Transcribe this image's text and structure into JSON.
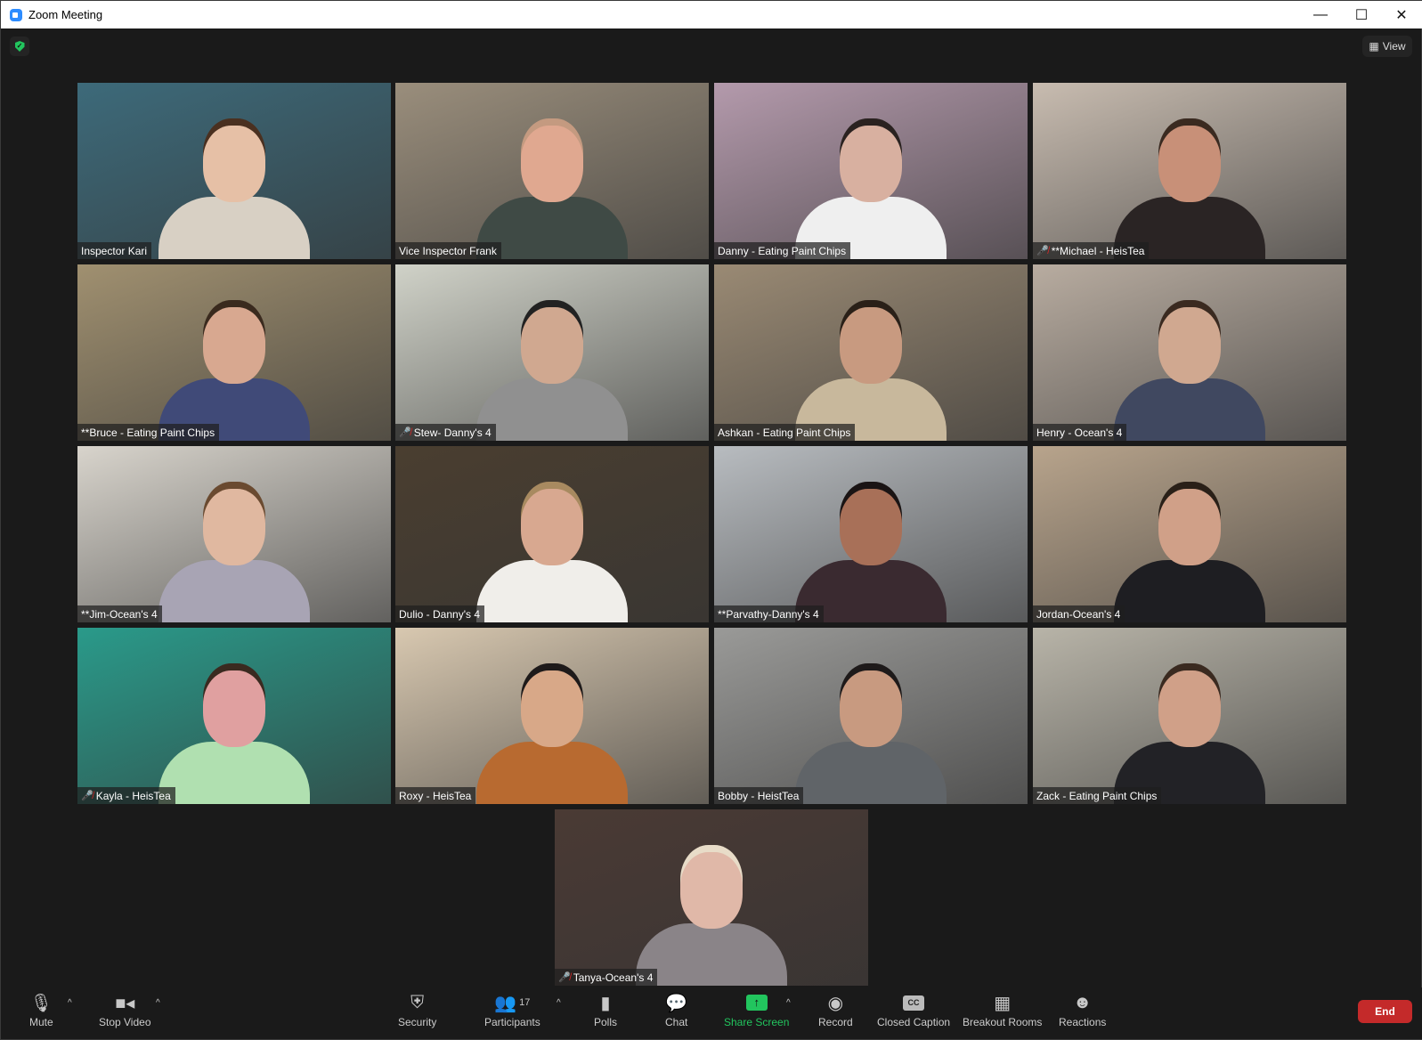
{
  "window": {
    "title": "Zoom Meeting",
    "minimize": "—",
    "maximize": "☐",
    "close": "✕"
  },
  "header": {
    "view_label": "View",
    "security_status": "encrypted"
  },
  "active_speaker": "Vice Inspector Frank",
  "participants": [
    {
      "name": "Inspector Kari",
      "muted": false,
      "bg": "#3d6a7a",
      "skin": "#e6c0a6",
      "shirt": "#d8d0c4",
      "hair": "#4a3020"
    },
    {
      "name": "Vice Inspector Frank",
      "muted": false,
      "bg": "#9a8e7c",
      "skin": "#e0a890",
      "shirt": "#3f4a45",
      "hair": "#c49a80"
    },
    {
      "name": "Danny - Eating Paint Chips",
      "muted": false,
      "bg": "#b49aac",
      "skin": "#d8b0a0",
      "shirt": "#efefef",
      "hair": "#2a2220"
    },
    {
      "name": "**Michael - HeisTea",
      "muted": true,
      "bg": "#c8bcb0",
      "skin": "#c89078",
      "shirt": "#2a2424",
      "hair": "#3a2a20"
    },
    {
      "name": "**Bruce - Eating Paint Chips",
      "muted": false,
      "bg": "#a09070",
      "skin": "#d8a890",
      "shirt": "#404a78",
      "hair": "#3a2a1e"
    },
    {
      "name": "Stew- Danny's 4",
      "muted": true,
      "bg": "#d0d2c8",
      "skin": "#d0a890",
      "shirt": "#909090",
      "hair": "#222"
    },
    {
      "name": "Ashkan - Eating Paint Chips",
      "muted": false,
      "bg": "#9a8a74",
      "skin": "#c89a80",
      "shirt": "#c8b89c",
      "hair": "#2a2018"
    },
    {
      "name": "Henry - Ocean's 4",
      "muted": false,
      "bg": "#b8aca0",
      "skin": "#d0a890",
      "shirt": "#404860",
      "hair": "#3a2a20"
    },
    {
      "name": "**Jim-Ocean's 4",
      "muted": false,
      "bg": "#d8d4cc",
      "skin": "#e0b8a0",
      "shirt": "#a8a4b4",
      "hair": "#6a4a30"
    },
    {
      "name": "Dulio - Danny's 4",
      "muted": false,
      "bg": "#4a3e30",
      "skin": "#d8a890",
      "shirt": "#f0eeea",
      "hair": "#a88a60"
    },
    {
      "name": "**Parvathy-Danny's 4",
      "muted": false,
      "bg": "#b8bcc0",
      "skin": "#a87058",
      "shirt": "#3a2a30",
      "hair": "#1a1414"
    },
    {
      "name": "Jordan-Ocean's 4",
      "muted": false,
      "bg": "#b8a48c",
      "skin": "#d0a088",
      "shirt": "#1e1e22",
      "hair": "#2a2018"
    },
    {
      "name": "Kayla - HeisTea",
      "muted": true,
      "bg": "#2a9a8a",
      "skin": "#e0a0a0",
      "shirt": "#b0e0b0",
      "hair": "#3a2a20"
    },
    {
      "name": "Roxy - HeisTea",
      "muted": false,
      "bg": "#d8c8b0",
      "skin": "#d8a888",
      "shirt": "#b86a30",
      "hair": "#1e1a1a"
    },
    {
      "name": "Bobby - HeistTea",
      "muted": false,
      "bg": "#9a9a98",
      "skin": "#c89a80",
      "shirt": "#606468",
      "hair": "#1e1a1a"
    },
    {
      "name": "Zack - Eating Paint Chips",
      "muted": false,
      "bg": "#b8b4a8",
      "skin": "#d0a088",
      "shirt": "#222226",
      "hair": "#3a2a20"
    },
    {
      "name": "Tanya-Ocean's 4",
      "muted": true,
      "bg": "#4a3a34",
      "skin": "#e0b8a8",
      "shirt": "#8a8488",
      "hair": "#e8dcc8"
    }
  ],
  "toolbar": {
    "mute": "Mute",
    "stop_video": "Stop Video",
    "security": "Security",
    "participants": "Participants",
    "participant_count": "17",
    "polls": "Polls",
    "chat": "Chat",
    "share_screen": "Share Screen",
    "record": "Record",
    "closed_caption": "Closed Caption",
    "cc_icon": "CC",
    "breakout_rooms": "Breakout Rooms",
    "reactions": "Reactions",
    "end": "End",
    "caret": "^"
  },
  "colors": {
    "accent_green": "#22c55e",
    "end_red": "#c42a2a",
    "active_speaker_border": "#e6e86b",
    "zoom_blue": "#2d8cff"
  }
}
